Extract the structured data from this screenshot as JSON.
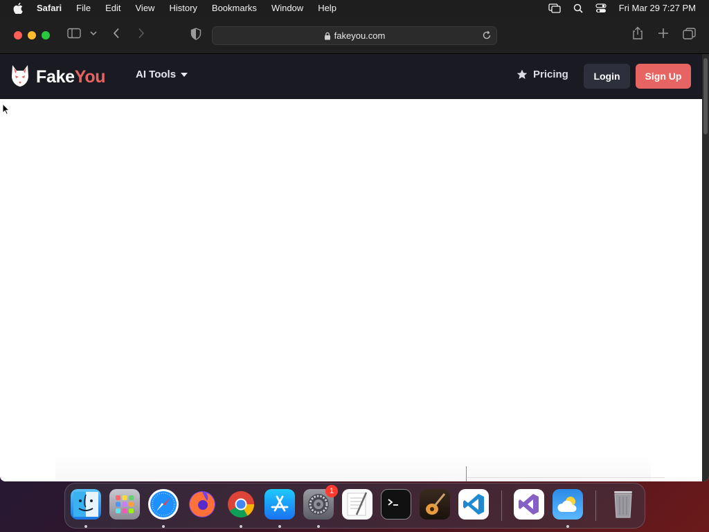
{
  "menubar": {
    "app_name": "Safari",
    "items": [
      "File",
      "Edit",
      "View",
      "History",
      "Bookmarks",
      "Window",
      "Help"
    ],
    "clock": "Fri Mar 29  7:27 PM"
  },
  "browser": {
    "url": "fakeyou.com"
  },
  "site": {
    "brand_part1": "Fake",
    "brand_part2": "You",
    "ai_tools_label": "AI Tools",
    "pricing_label": "Pricing",
    "login_label": "Login",
    "signup_label": "Sign Up",
    "accent_color": "#e66462"
  },
  "dock": {
    "apps": [
      "Finder",
      "Launchpad",
      "Safari",
      "Firefox",
      "Chrome",
      "App Store",
      "System Preferences",
      "TextEdit",
      "Terminal",
      "GarageBand",
      "Visual Studio Code",
      "Visual Studio",
      "Weather",
      "Trash"
    ],
    "settings_badge": "1"
  }
}
